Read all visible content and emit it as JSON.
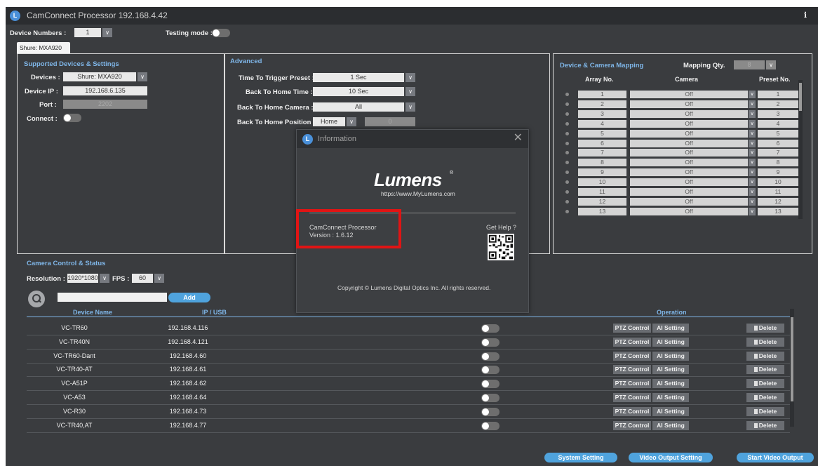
{
  "window": {
    "title": "CamConnect Processor 192.168.4.42",
    "logo_letter": "L"
  },
  "topbar": {
    "device_numbers_label": "Device Numbers :",
    "device_numbers_value": "1",
    "testing_mode_label": "Testing mode :"
  },
  "tab": {
    "label": "Shure: MXA920"
  },
  "supported": {
    "title": "Supported Devices & Settings",
    "devices_label": "Devices :",
    "devices_value": "Shure: MXA920",
    "ip_label": "Device IP :",
    "ip_value": "192.168.6.135",
    "port_label": "Port :",
    "port_value": "2202",
    "connect_label": "Connect :"
  },
  "advanced": {
    "title": "Advanced",
    "trigger_label": "Time To Trigger Preset :",
    "trigger_value": "1 Sec",
    "home_time_label": "Back To Home Time :",
    "home_time_value": "10 Sec",
    "home_camera_label": "Back To Home Camera :",
    "home_camera_value": "All",
    "home_position_label": "Back To Home Position :",
    "home_position_value": "Home",
    "home_position_preset": "0"
  },
  "mapping": {
    "title": "Device & Camera Mapping",
    "qty_label": "Mapping Qty.",
    "qty_value": "8",
    "col_array": "Array No.",
    "col_camera": "Camera",
    "col_preset": "Preset No.",
    "rows": [
      {
        "array": "1",
        "camera": "Off",
        "preset": "1"
      },
      {
        "array": "2",
        "camera": "Off",
        "preset": "2"
      },
      {
        "array": "3",
        "camera": "Off",
        "preset": "3"
      },
      {
        "array": "4",
        "camera": "Off",
        "preset": "4"
      },
      {
        "array": "5",
        "camera": "Off",
        "preset": "5"
      },
      {
        "array": "6",
        "camera": "Off",
        "preset": "6"
      },
      {
        "array": "7",
        "camera": "Off",
        "preset": "7"
      },
      {
        "array": "8",
        "camera": "Off",
        "preset": "8"
      },
      {
        "array": "9",
        "camera": "Off",
        "preset": "9"
      },
      {
        "array": "10",
        "camera": "Off",
        "preset": "10"
      },
      {
        "array": "11",
        "camera": "Off",
        "preset": "11"
      },
      {
        "array": "12",
        "camera": "Off",
        "preset": "12"
      },
      {
        "array": "13",
        "camera": "Off",
        "preset": "13"
      }
    ]
  },
  "camera_control": {
    "title": "Camera Control & Status",
    "resolution_label": "Resolution :",
    "resolution_value": "1920*1080",
    "fps_label": "FPS :",
    "fps_value": "60",
    "add_label": "Add",
    "col_device": "Device Name",
    "col_ip": "IP / USB",
    "col_operation": "Operation",
    "ptz_label": "PTZ Control",
    "ai_label": "AI Setting",
    "delete_label": "Delete",
    "devices": [
      {
        "name": "VC-TR60",
        "ip": "192.168.4.116"
      },
      {
        "name": "VC-TR40N",
        "ip": "192.168.4.121"
      },
      {
        "name": "VC-TR60-Dant",
        "ip": "192.168.4.60"
      },
      {
        "name": "VC-TR40-AT",
        "ip": "192.168.4.61"
      },
      {
        "name": "VC-A51P",
        "ip": "192.168.4.62"
      },
      {
        "name": "VC-A53",
        "ip": "192.168.4.64"
      },
      {
        "name": "VC-R30",
        "ip": "192.168.4.73"
      },
      {
        "name": "VC-TR40,AT",
        "ip": "192.168.4.77"
      }
    ]
  },
  "footer": {
    "system_setting": "System Setting",
    "video_output_setting": "Video Output Setting",
    "start_video_output": "Start Video Output"
  },
  "info_dialog": {
    "title": "Information",
    "brand": "Lumens",
    "brand_mark": "®",
    "url": "https://www.MyLumens.com",
    "product": "CamConnect Processor",
    "version": "Version : 1.6.12",
    "get_help": "Get Help ?",
    "copyright": "Copyright © Lumens Digital Optics Inc. All rights reserved."
  },
  "colors": {
    "accent": "#4fa3dd",
    "panel_bg": "#3a3c3f",
    "title_blue": "#7fb6e8",
    "highlight": "#e01414"
  }
}
